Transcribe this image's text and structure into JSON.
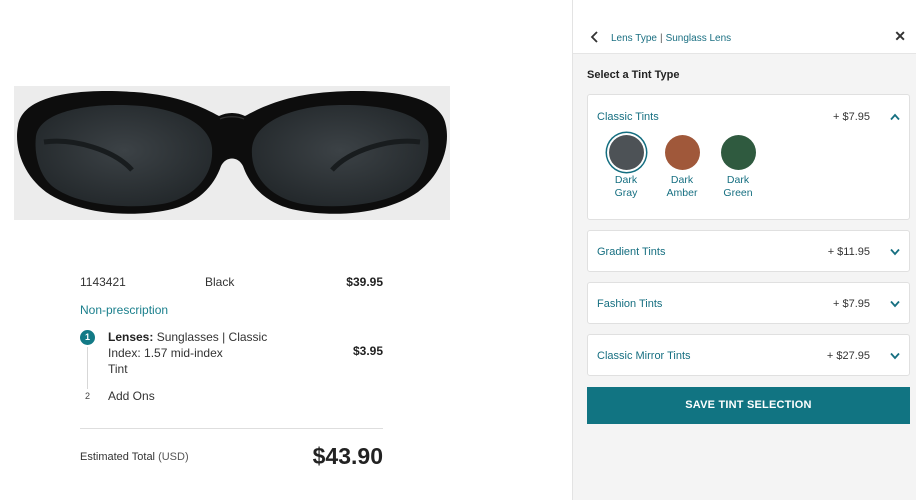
{
  "product": {
    "sku": "1143421",
    "color": "Black",
    "frame_price": "$39.95",
    "prescription": "Non-prescription",
    "steps": [
      {
        "number": "1",
        "lenses_label": "Lenses:",
        "lenses_value": "Sunglasses | Classic",
        "index_label": "Index:",
        "index_value": "1.57 mid-index",
        "tint": "Tint",
        "price": "$3.95"
      },
      {
        "number": "2",
        "label": "Add Ons"
      }
    ],
    "total_label": "Estimated Total",
    "total_currency": "(USD)",
    "total_amount": "$43.90"
  },
  "panel": {
    "breadcrumb": [
      "Lens Type",
      "Sunglass Lens"
    ],
    "breadcrumb_sep": "|",
    "close_symbol": "✕",
    "section_title": "Select a Tint Type",
    "accordions": [
      {
        "label": "Classic Tints",
        "price": "+ $7.95",
        "expanded": true
      },
      {
        "label": "Gradient Tints",
        "price": "+ $11.95",
        "expanded": false
      },
      {
        "label": "Fashion Tints",
        "price": "+ $7.95",
        "expanded": false
      },
      {
        "label": "Classic Mirror Tints",
        "price": "+ $27.95",
        "expanded": false
      }
    ],
    "tints": [
      {
        "line1": "Dark",
        "line2": "Gray",
        "color": "#4d5256",
        "selected": true
      },
      {
        "line1": "Dark",
        "line2": "Amber",
        "color": "#a0583a",
        "selected": false
      },
      {
        "line1": "Dark",
        "line2": "Green",
        "color": "#2f5a3f",
        "selected": false
      }
    ],
    "save_label": "SAVE TINT SELECTION"
  },
  "colors": {
    "accent": "#117482",
    "link": "#166f81"
  }
}
